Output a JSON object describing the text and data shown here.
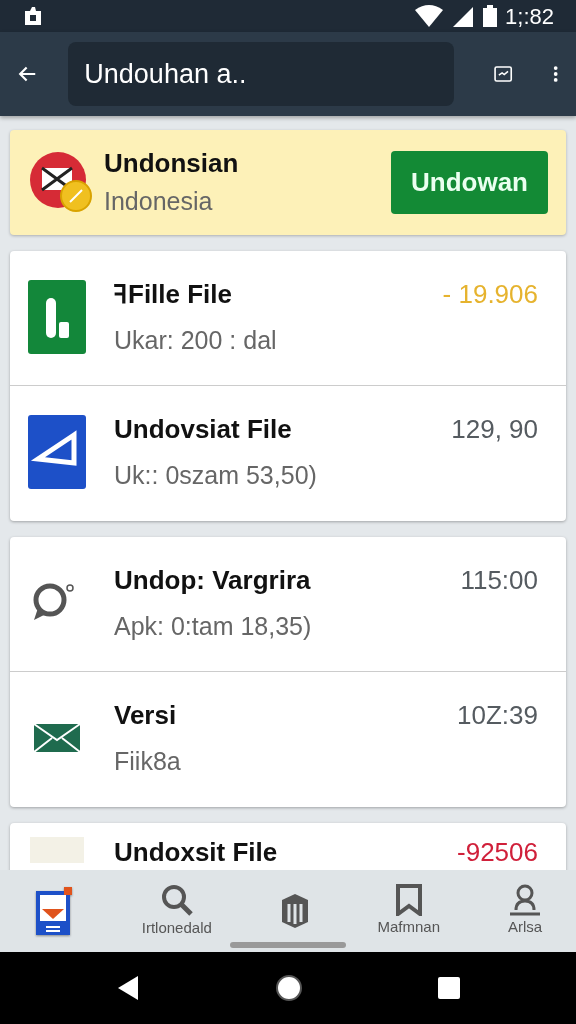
{
  "status_bar": {
    "time": "1;:82"
  },
  "app_bar": {
    "search_value": "Undouhan a.."
  },
  "banner": {
    "title": "Undonsian",
    "subtitle": "Indonesia",
    "button": "Undowan"
  },
  "cards": [
    {
      "items": [
        {
          "kind": "app-green",
          "title": "ꟻFille File",
          "subtitle": "Ukar: 200 : dal",
          "amount": "- 19.906",
          "color": "#e6b32e"
        },
        {
          "kind": "app-blue",
          "title": "Undovsiat File",
          "subtitle": "Uk:: 0szam 53,50)",
          "amount": "129, 90",
          "color": "#555b60"
        }
      ]
    },
    {
      "items": [
        {
          "kind": "chat",
          "title": "Undop: Vargrira",
          "subtitle": "Apk: 0:tam 18,35)",
          "amount": "115:00",
          "color": "#555b60"
        },
        {
          "kind": "mail",
          "title": "Versi",
          "subtitle": "Fiik8a",
          "amount": "10Z:39",
          "color": "#555b60"
        }
      ]
    },
    {
      "items": [
        {
          "kind": "doc",
          "title": "Undoxsit File",
          "amount": "-92506",
          "color": "#d0203a"
        }
      ]
    }
  ],
  "bottom_nav": [
    {
      "kind": "app",
      "selected": true
    },
    {
      "kind": "search",
      "label": "Irtlonedald",
      "selected": false
    },
    {
      "kind": "shield",
      "selected": false
    },
    {
      "kind": "bookmark",
      "label": "Mafmnan",
      "selected": false
    },
    {
      "kind": "person",
      "label": "Arlsa",
      "selected": false
    }
  ]
}
